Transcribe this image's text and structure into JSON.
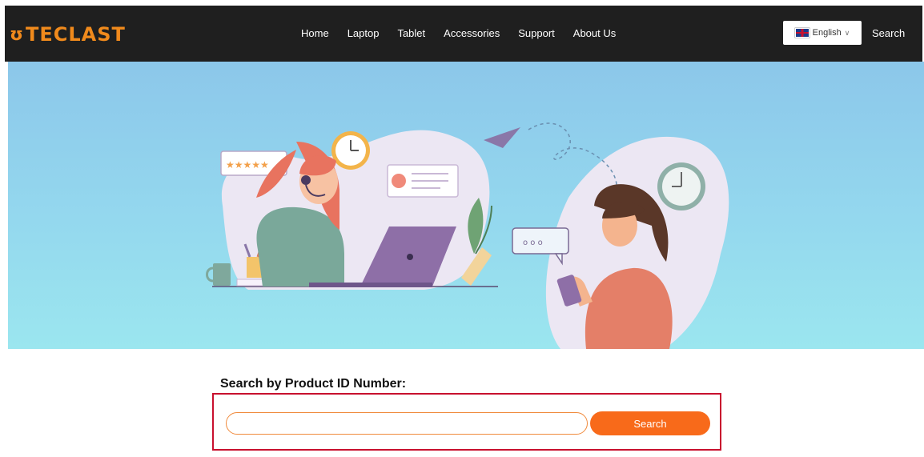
{
  "brand": {
    "logo_text": "TECLAST",
    "logo_color": "#f08a1c"
  },
  "nav": {
    "items": [
      "Home",
      "Laptop",
      "Tablet",
      "Accessories",
      "Support",
      "About Us"
    ]
  },
  "language": {
    "selected": "English",
    "flag_icon": "uk-flag-icon",
    "chevron_icon": "chevron-down-icon"
  },
  "header_search_label": "Search",
  "banner": {
    "illustration": "customer-support-illustration",
    "dialog_dots": "o o o"
  },
  "search": {
    "title": "Search by Product ID Number:",
    "input_value": "",
    "input_placeholder": "",
    "button_label": "Search",
    "accent_color": "#f86a1a",
    "highlight_color": "#c8102e"
  }
}
